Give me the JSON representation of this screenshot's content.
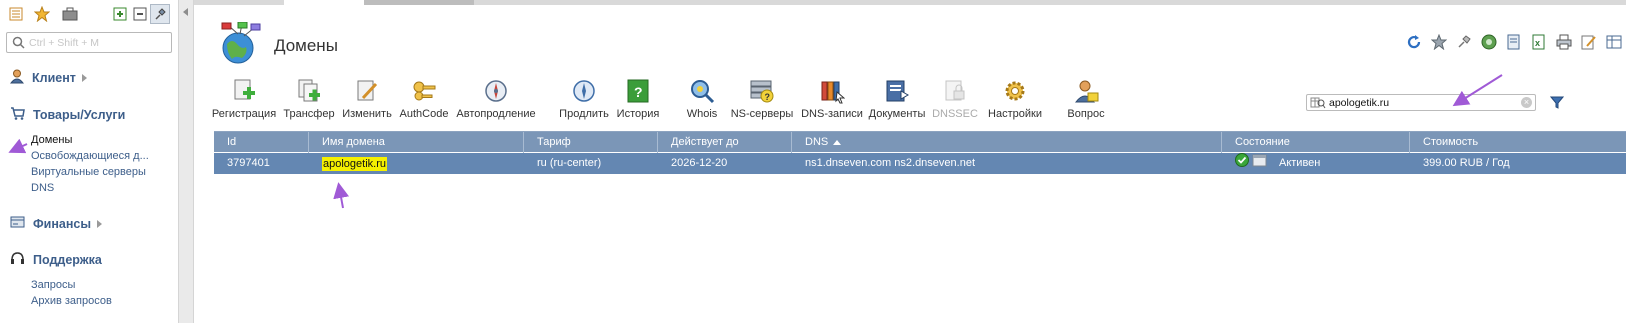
{
  "sidebar": {
    "toolbar_icons": [
      "list-icon",
      "favorites-star-icon",
      "briefcase-icon",
      "expand-all-icon",
      "collapse-all-icon",
      "pin-icon"
    ],
    "search": {
      "placeholder": "Ctrl + Shift + M"
    },
    "groups": {
      "client": {
        "label": "Клиент",
        "icon": "user-icon"
      },
      "products": {
        "label": "Товары/Услуги",
        "icon": "cart-icon"
      },
      "finance": {
        "label": "Финансы",
        "icon": "finance-icon"
      },
      "support": {
        "label": "Поддержка",
        "icon": "headset-icon"
      }
    },
    "products_items": [
      "Домены",
      "Освобождающиеся д...",
      "Виртуальные серверы",
      "DNS"
    ],
    "support_items": [
      "Запросы",
      "Архив запросов"
    ]
  },
  "page": {
    "title": "Домены",
    "icon": "globe-icon"
  },
  "right_tools": [
    "refresh-icon",
    "star-icon",
    "pin-icon",
    "dashboard-icon",
    "export-icon",
    "excel-icon",
    "print-icon",
    "edit-icon",
    "table-settings-icon"
  ],
  "toolbar": {
    "register": "Регистрация",
    "transfer": "Трансфер",
    "edit": "Изменить",
    "authcode": "AuthCode",
    "autorenew": "Автопродление",
    "renew": "Продлить",
    "history": "История",
    "whois": "Whois",
    "ns": "NS-серверы",
    "dns_records": "DNS-записи",
    "documents": "Документы",
    "dnssec": "DNSSEC",
    "settings": "Настройки",
    "question": "Вопрос"
  },
  "filter": {
    "value": "apologetik.ru"
  },
  "grid": {
    "columns": {
      "id": "Id",
      "domain": "Имя домена",
      "tariff": "Тариф",
      "valid_until": "Действует до",
      "dns": "DNS",
      "state": "Состояние",
      "cost": "Стоимость"
    },
    "rows": [
      {
        "id": "3797401",
        "domain": "apologetik.ru",
        "tariff": "ru (ru-center)",
        "valid_until": "2026-12-20",
        "dns": "ns1.dnseven.com ns2.dnseven.net",
        "state": "Активен",
        "cost": "399.00 RUB / Год"
      }
    ]
  },
  "colors": {
    "header_bg": "#7b96b7",
    "selected_row_bg": "#6487b2",
    "highlight": "#f5f000",
    "link": "#3d5e8a",
    "annotation_arrow": "#a05ad6"
  }
}
